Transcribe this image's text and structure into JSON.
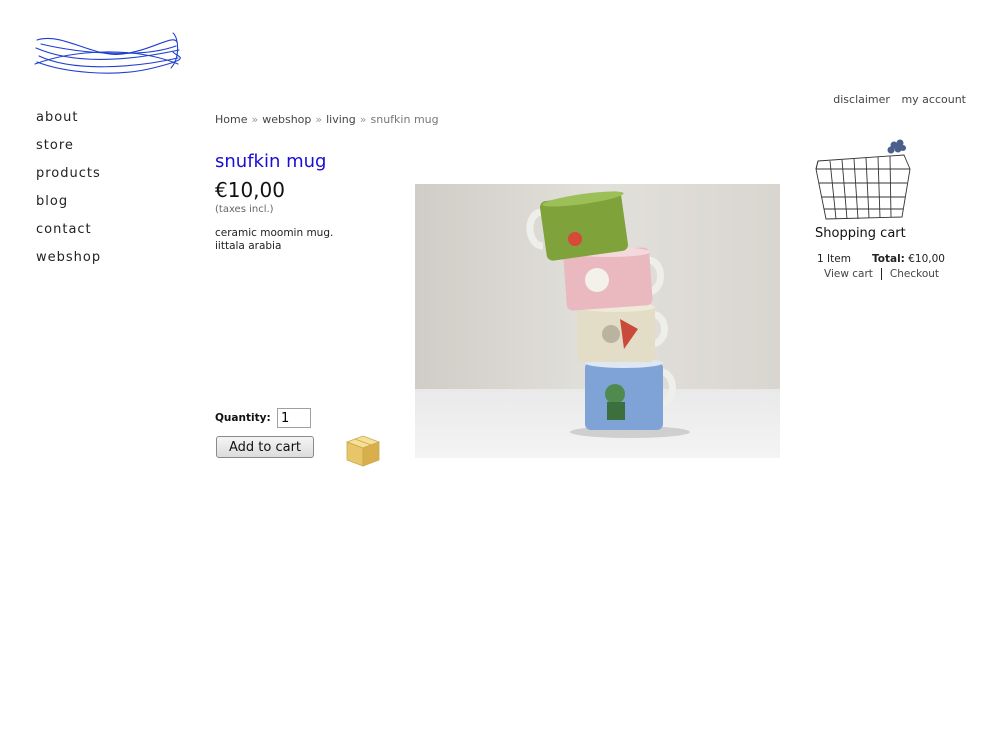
{
  "nav": {
    "items": [
      "about",
      "store",
      "products",
      "blog",
      "contact",
      "webshop"
    ]
  },
  "toplinks": {
    "disclaimer": "disclaimer",
    "account": "my account"
  },
  "breadcrumb": {
    "home": "Home",
    "webshop": "webshop",
    "living": "living",
    "current": "snufkin mug",
    "separator": "»"
  },
  "product": {
    "title": "snufkin mug",
    "price": "€10,00",
    "taxes": "(taxes incl.)",
    "description_line1": "ceramic moomin mug.",
    "description_line2": "iittala arabia",
    "quantity_label": "Quantity:",
    "quantity_value": "1",
    "add_to_cart_label": "Add to cart",
    "image_icon": "product-photo-stacked-moomin-mugs"
  },
  "cart": {
    "title": "Shopping cart",
    "items": "1 Item",
    "total_label": "Total:",
    "total_value": "€10,00",
    "view_cart": "View cart",
    "checkout": "Checkout",
    "icon": "wire-basket-icon"
  },
  "colors": {
    "title": "#1a0dd6",
    "logo": "#1f3fd0"
  }
}
